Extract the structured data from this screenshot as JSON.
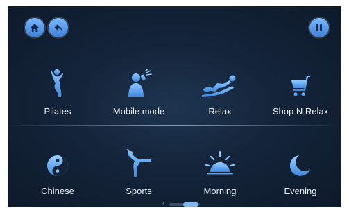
{
  "toolbar": {
    "home_icon": "home-icon",
    "back_icon": "back-arrow-icon",
    "pause_icon": "pause-icon"
  },
  "modes": {
    "row1": [
      {
        "label": "Pilates",
        "icon": "pilates-figure-icon"
      },
      {
        "label": "Mobile mode",
        "icon": "mobile-person-icon"
      },
      {
        "label": "Relax",
        "icon": "reclining-person-icon"
      },
      {
        "label": "Shop N Relax",
        "icon": "shopping-cart-icon"
      }
    ],
    "row2": [
      {
        "label": "Chinese",
        "icon": "yin-yang-icon"
      },
      {
        "label": "Sports",
        "icon": "stretching-figure-icon"
      },
      {
        "label": "Morning",
        "icon": "sunrise-icon"
      },
      {
        "label": "Evening",
        "icon": "crescent-moon-icon"
      }
    ]
  },
  "pager": {
    "prev_glyph": "‹"
  },
  "colors": {
    "accent": "#5aa9f5",
    "background": "#14243a",
    "text": "#e8eef6"
  }
}
